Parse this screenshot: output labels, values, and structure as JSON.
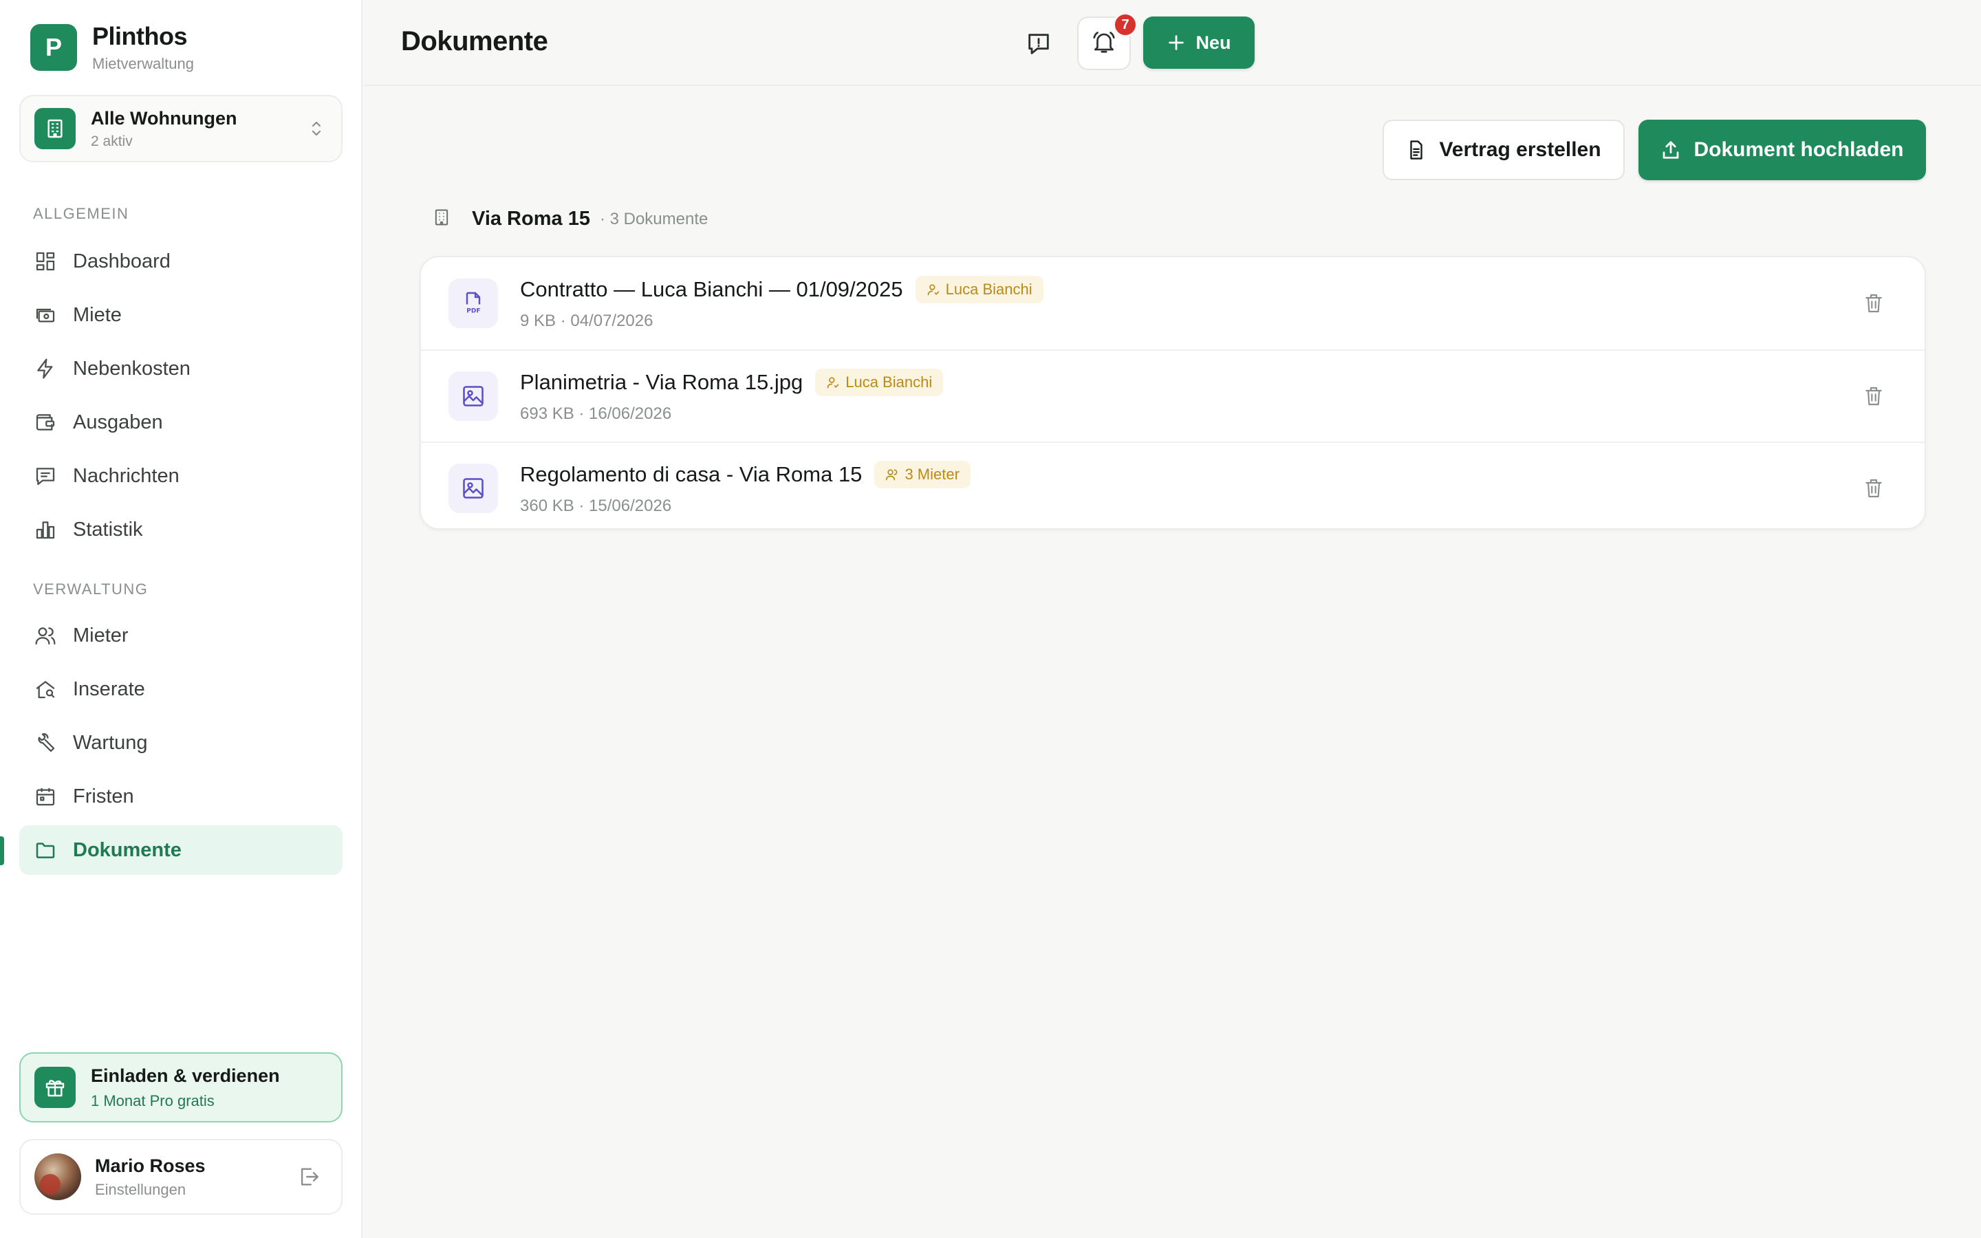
{
  "brand": {
    "logo_letter": "P",
    "name": "Plinthos",
    "subtitle": "Mietverwaltung"
  },
  "property_switcher": {
    "title": "Alle Wohnungen",
    "subtitle": "2 aktiv"
  },
  "sidebar": {
    "sections": [
      {
        "label": "ALLGEMEIN"
      },
      {
        "label": "VERWALTUNG"
      }
    ],
    "items": [
      {
        "label": "Dashboard",
        "icon": "dashboard-icon"
      },
      {
        "label": "Miete",
        "icon": "cash-icon"
      },
      {
        "label": "Nebenkosten",
        "icon": "lightning-icon"
      },
      {
        "label": "Ausgaben",
        "icon": "wallet-icon"
      },
      {
        "label": "Nachrichten",
        "icon": "message-icon"
      },
      {
        "label": "Statistik",
        "icon": "bar-chart-icon"
      },
      {
        "label": "Mieter",
        "icon": "users-icon"
      },
      {
        "label": "Inserate",
        "icon": "home-search-icon"
      },
      {
        "label": "Wartung",
        "icon": "wrench-icon"
      },
      {
        "label": "Fristen",
        "icon": "calendar-icon"
      },
      {
        "label": "Dokumente",
        "icon": "folder-icon",
        "active": true
      }
    ]
  },
  "invite": {
    "title": "Einladen & verdienen",
    "subtitle": "1 Monat Pro gratis"
  },
  "user": {
    "name": "Mario Roses",
    "subtitle": "Einstellungen"
  },
  "header": {
    "title": "Dokumente",
    "notifications_count": "7",
    "new_label": "Neu"
  },
  "actions": {
    "contract_label": "Vertrag erstellen",
    "upload_label": "Dokument hochladen"
  },
  "group": {
    "title": "Via Roma 15",
    "count": "· 3 Dokumente",
    "documents": [
      {
        "name": "Contratto — Luca Bianchi — 01/09/2025",
        "tag": "Luca Bianchi",
        "meta": "9 KB · 04/07/2026",
        "type": "pdf"
      },
      {
        "name": "Planimetria - Via Roma 15.jpg",
        "tag": "Luca Bianchi",
        "meta": "693 KB · 16/06/2026",
        "type": "image"
      },
      {
        "name": "Regolamento di casa - Via Roma 15",
        "tag": "3 Mieter",
        "meta": "360 KB · 15/06/2026",
        "type": "image"
      }
    ]
  },
  "colors": {
    "accent": "#1f8a5b",
    "active_bg": "#e7f6ee",
    "tag_bg": "#fbf4e1",
    "tag_text": "#b98a1a",
    "badge": "#d7322b"
  }
}
